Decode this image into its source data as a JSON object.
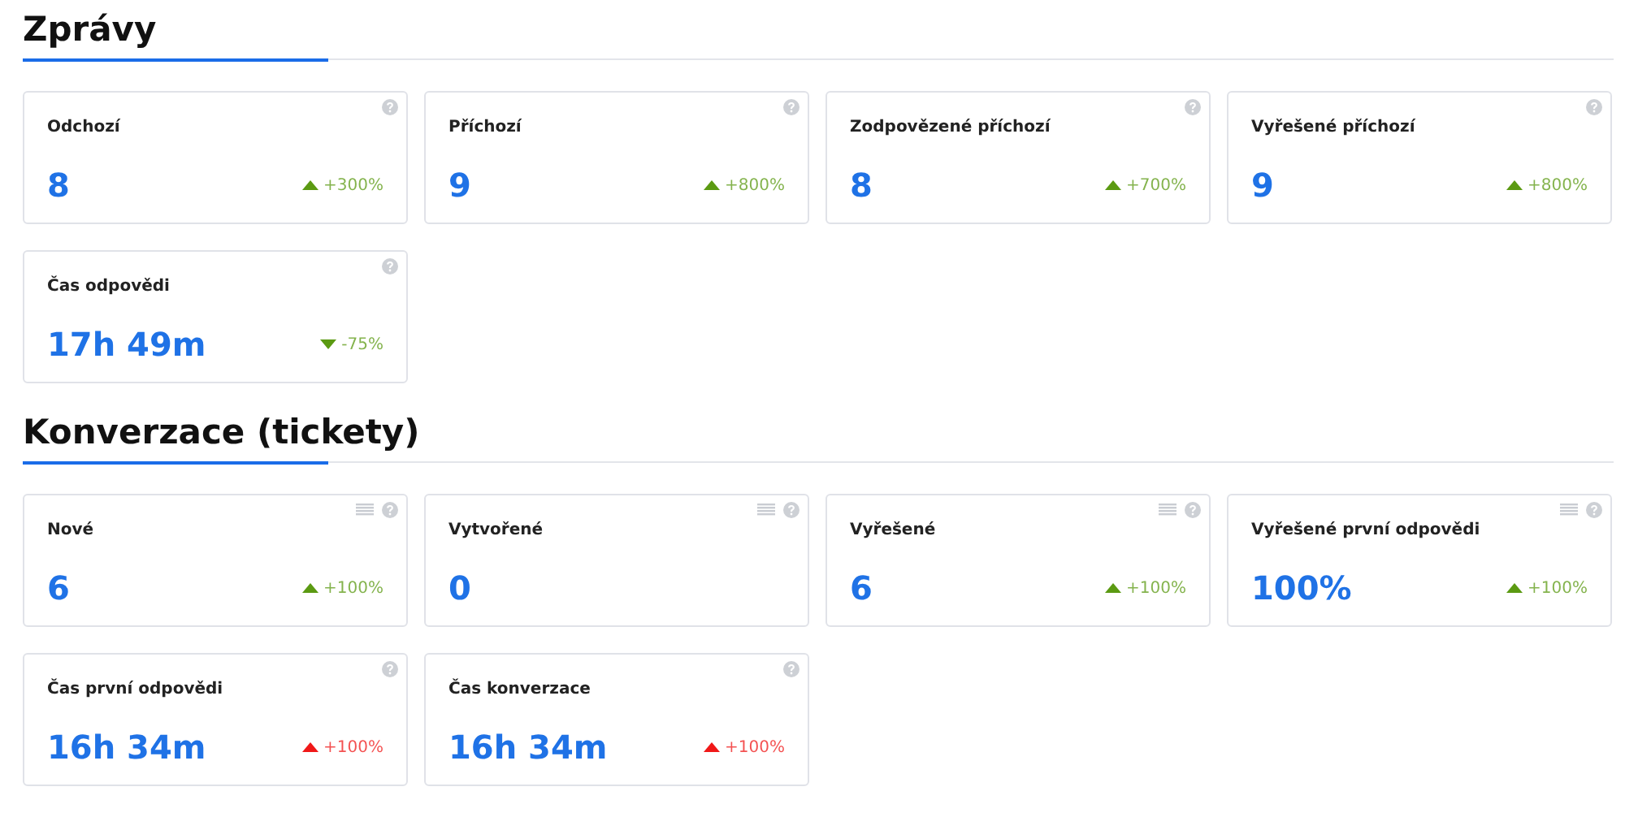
{
  "sections": [
    {
      "title": "Zprávy",
      "cards": [
        {
          "title": "Odchozí",
          "value": "8",
          "has_list": false,
          "trend": {
            "kind": "up",
            "color": "#5b9a12",
            "text": "+300%"
          }
        },
        {
          "title": "Příchozí",
          "value": "9",
          "has_list": false,
          "trend": {
            "kind": "up",
            "color": "#5b9a12",
            "text": "+800%"
          }
        },
        {
          "title": "Zodpovězené příchozí",
          "value": "8",
          "has_list": false,
          "trend": {
            "kind": "up",
            "color": "#5b9a12",
            "text": "+700%"
          }
        },
        {
          "title": "Vyřešené příchozí",
          "value": "9",
          "has_list": false,
          "trend": {
            "kind": "up",
            "color": "#5b9a12",
            "text": "+800%"
          }
        },
        {
          "title": "Čas odpovědi",
          "value": "17h 49m",
          "has_list": false,
          "trend": {
            "kind": "down",
            "color": "#5b9a12",
            "text": "-75%"
          }
        }
      ]
    },
    {
      "title": "Konverzace (tickety)",
      "cards": [
        {
          "title": "Nové",
          "value": "6",
          "has_list": true,
          "trend": {
            "kind": "up",
            "color": "#5b9a12",
            "text": "+100%"
          }
        },
        {
          "title": "Vytvořené",
          "value": "0",
          "has_list": true
        },
        {
          "title": "Vyřešené",
          "value": "6",
          "has_list": true,
          "trend": {
            "kind": "up",
            "color": "#5b9a12",
            "text": "+100%"
          }
        },
        {
          "title": "Vyřešené první odpovědi",
          "value": "100%",
          "has_list": true,
          "trend": {
            "kind": "up",
            "color": "#5b9a12",
            "text": "+100%"
          }
        },
        {
          "title": "Čas první odpovědi",
          "value": "16h 34m",
          "has_list": false,
          "trend": {
            "kind": "up",
            "color": "#f01818",
            "text": "+100%"
          }
        },
        {
          "title": "Čas konverzace",
          "value": "16h 34m",
          "has_list": false,
          "trend": {
            "kind": "up",
            "color": "#f01818",
            "text": "+100%"
          }
        }
      ]
    }
  ]
}
